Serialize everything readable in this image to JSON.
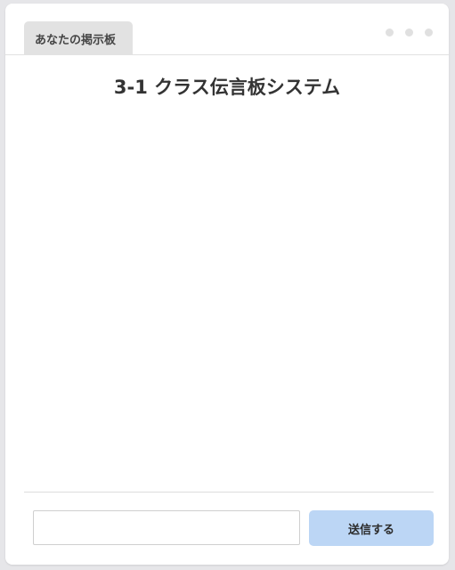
{
  "window": {
    "tab_label": "あなたの掲示板"
  },
  "main": {
    "title": "3-1 クラス伝言板システム",
    "messages": []
  },
  "composer": {
    "input_value": "",
    "input_placeholder": "",
    "send_label": "送信する"
  },
  "colors": {
    "background": "#e6e6e9",
    "card": "#ffffff",
    "tab": "#e2e2e2",
    "send_button": "#bcd6f5",
    "title_text": "#333333"
  },
  "icons": {
    "menu": "more-horizontal-dots-icon"
  }
}
